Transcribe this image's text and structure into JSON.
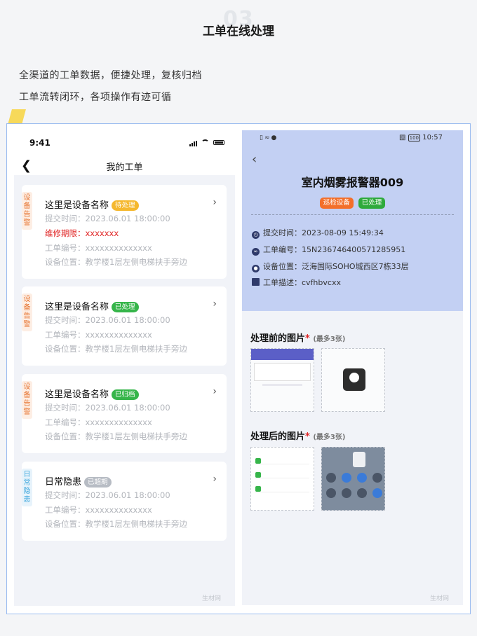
{
  "header": {
    "section_number": "03",
    "title": "工单在线处理",
    "desc_line1": "全渠道的工单数据，便捷处理，复核归档",
    "desc_line2": "工单流转闭环，各项操作有迹可循"
  },
  "left_phone": {
    "status_time": "9:41",
    "nav_title": "我的工单",
    "back_icon": "chevron-left-icon",
    "cards": [
      {
        "tag": "设备告警",
        "tag_color": "#e6722e",
        "title": "这里是设备名称",
        "badge": "待处理",
        "badge_color": "#f5b82e",
        "submit_time": "提交时间：2023.06.01 18:00:00",
        "deadline": "维修期限：xxxxxxx",
        "order_no": "工单编号：xxxxxxxxxxxxxx",
        "location": "设备位置：教学楼1层左侧电梯扶手旁边"
      },
      {
        "tag": "设备告警",
        "tag_color": "#e6722e",
        "title": "这里是设备名称",
        "badge": "已处理",
        "badge_color": "#36b54a",
        "submit_time": "提交时间：2023.06.01 18:00:00",
        "order_no": "工单编号：xxxxxxxxxxxxxx",
        "location": "设备位置：教学楼1层左侧电梯扶手旁边"
      },
      {
        "tag": "设备告警",
        "tag_color": "#e6722e",
        "title": "这里是设备名称",
        "badge": "已归档",
        "badge_color": "#36b54a",
        "submit_time": "提交时间：2023.06.01 18:00:00",
        "order_no": "工单编号：xxxxxxxxxxxxxx",
        "location": "设备位置：教学楼1层左侧电梯扶手旁边"
      },
      {
        "tag": "日常隐患",
        "tag_color": "#3aa5dc",
        "title": "日常隐患",
        "badge": "已超期",
        "badge_color": "#b7bcc4",
        "submit_time": "提交时间：2023.06.01 18:00:00",
        "order_no": "工单编号：xxxxxxxxxxxxxx",
        "location": "设备位置：教学楼1层左侧电梯扶手旁边"
      }
    ],
    "watermark": "生材网"
  },
  "right_phone": {
    "status_time": "10:57",
    "battery": "100",
    "title": "室内烟雾报警器009",
    "badges": [
      "巡检设备",
      "已处理"
    ],
    "submit_time": "提交时间：2023-08-09 15:49:34",
    "order_no": "工单编号：15N236746400571285951",
    "location": "设备位置：泛海国际SOHO城西区7栋33层",
    "description": "工单描述：cvfhbvcxx",
    "before_title": "处理前的图片",
    "before_note": "(最多3张)",
    "after_title": "处理后的图片",
    "after_note": "(最多3张)",
    "watermark": "生材网",
    "colors": {
      "header_bg": "#c3d0f3",
      "badge_orange": "#f36f2a",
      "badge_green": "#2faa3c"
    }
  }
}
